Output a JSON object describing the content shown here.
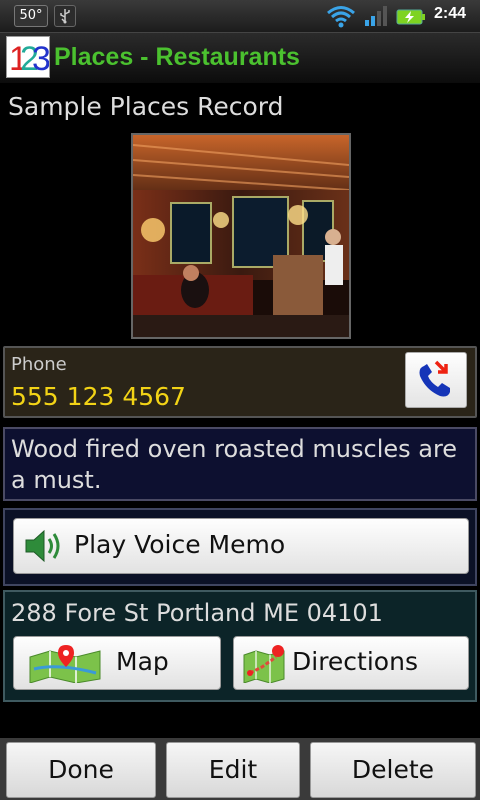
{
  "status_bar": {
    "temperature": "50°",
    "time": "2:44",
    "icons": [
      "usb-icon",
      "wifi-icon",
      "signal-icon",
      "battery-charging-icon"
    ]
  },
  "title_bar": {
    "logo": "123-logo",
    "title": "Places - Restaurants"
  },
  "record": {
    "name": "Sample Places Record",
    "photo": "restaurant-interior-photo"
  },
  "phone": {
    "label": "Phone",
    "number": "555 123 4567",
    "call_icon": "phone-call-icon"
  },
  "note": "Wood fired oven roasted muscles are a must.",
  "voice_memo": {
    "label": "Play Voice Memo",
    "icon": "speaker-icon"
  },
  "address": {
    "text": "288 Fore St Portland ME 04101",
    "map_label": "Map",
    "directions_label": "Directions"
  },
  "actions": {
    "done": "Done",
    "edit": "Edit",
    "delete": "Delete"
  },
  "colors": {
    "title": "#4bc12f",
    "phone_number": "#f2d316",
    "phone_panel": "#2a2418",
    "note_panel": "#0d1030",
    "address_panel": "#0c2428"
  }
}
